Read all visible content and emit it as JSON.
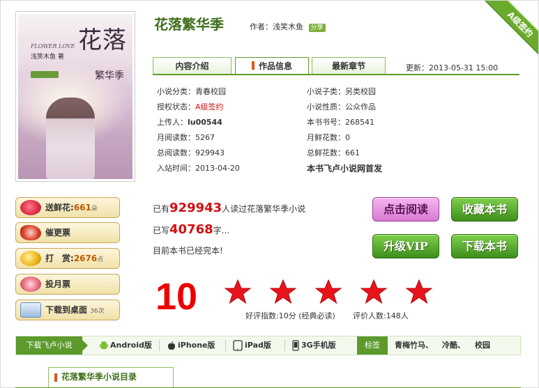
{
  "book": {
    "title": "花落繁华季",
    "author_label": "作者：",
    "author": "浅笑木鱼",
    "share": "分享",
    "ribbon": "A级签约"
  },
  "cover": {
    "title_big": "花落",
    "title_small": "繁华季",
    "subtitle": "FLOWER LOVE",
    "author_text": "浅笑木鱼 著"
  },
  "tabs": {
    "intro": "内容介绍",
    "info": "作品信息",
    "latest": "最新章节",
    "updated": "更新：2013-05-31 15:00"
  },
  "info": {
    "category_label": "小说分类：",
    "category": "青春校园",
    "subcategory_label": "小说子类：",
    "subcategory": "另类校园",
    "auth_label": "授权状态：",
    "auth": "A级签约",
    "nature_label": "小说性质：",
    "nature": "公众作品",
    "uploader_label": "上传人：",
    "uploader": "lu00544",
    "book_no_label": "本书书号：",
    "book_no": "268541",
    "monthly_reads_label": "月阅读数：",
    "monthly_reads": "5267",
    "monthly_flowers_label": "月鲜花数：",
    "monthly_flowers": "0",
    "total_reads_label": "总阅读数：",
    "total_reads": "929943",
    "total_flowers_label": "总鲜花数：",
    "total_flowers": "661",
    "join_label": "入站时间：",
    "join": "2013-04-20",
    "first_pub": "本书飞卢小说网首发"
  },
  "actions": {
    "flowers_label": "送鲜花:",
    "flowers_num": "661",
    "flowers_unit": "朵",
    "urge": "催更票",
    "reward_label": "打　赏:",
    "reward_num": "2676",
    "reward_unit": "点",
    "monthly_ticket": "投月票",
    "download_desktop": "下载到桌面",
    "download_count": "36次"
  },
  "stats": {
    "read_prefix": "已有",
    "read_num": "929943",
    "read_suffix": "人读过花落繁华季小说",
    "words_prefix": "已写",
    "words_num": "40768",
    "words_suffix": "字...",
    "status": "目前本书已经完本!"
  },
  "buttons": {
    "read": "点击阅读",
    "favorite": "收藏本书",
    "vip": "升级VIP",
    "download": "下载本书"
  },
  "rating": {
    "score": "10",
    "stars": 5,
    "note": "好评指数:10分 (经典必读)",
    "count": "评价人数:148人"
  },
  "platforms": {
    "label": "下载飞卢小说",
    "android": "Android版",
    "iphone": "iPhone版",
    "ipad": "iPad版",
    "g3": "3G手机版",
    "tags_label": "标签",
    "tags": [
      "青梅竹马、",
      "冷酷、",
      "校园"
    ]
  },
  "bottom": {
    "title": "花落繁华季小说目录"
  },
  "colors": {
    "brand_green": "#5b9a2b",
    "accent_red": "#d40f0f"
  }
}
